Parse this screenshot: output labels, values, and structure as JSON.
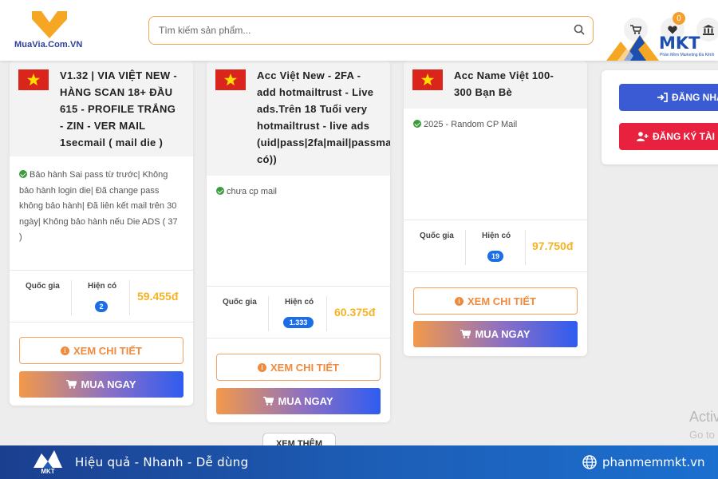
{
  "header": {
    "logo_text": "MuaVia.Com.VN",
    "search_placeholder": "Tìm kiếm sản phẩm...",
    "wishlist_count": "0"
  },
  "overlay_brand": {
    "name": "MKT",
    "tagline": "Phần Mềm Marketing Đa Kênh"
  },
  "products": [
    {
      "title_lines": [
        "V1.32 | VIA VIỆT NEW -",
        "HÀNG SCAN 18+ ĐẦU",
        "615 - PROFILE TRẮNG",
        "- ZIN - VER MAIL",
        "1secmail ( mail die )"
      ],
      "desc_lines": [
        "Bảo hành Sai pass từ trước| Không",
        "bảo hành login die| Đã change pass",
        "không bảo hành| Đã liên kết mail trên 30",
        "ngày| Không bảo hành nếu Die ADS ( 37",
        ")"
      ],
      "country_label": "Quốc gia",
      "stock_label": "Hiện có",
      "stock": "2",
      "price": "59.455đ",
      "detail_label": "XEM CHI TIẾT",
      "buy_label": "MUA NGAY"
    },
    {
      "title_lines": [
        "Acc Việt New - 2FA -",
        "add hotmailtrust - Live",
        "ads.Trên 18 Tuổi very",
        "hotmailtrust - live ads",
        "(uid|pass|2fa|mail|passma",
        "có))"
      ],
      "desc_lines": [
        "chưa cp mail"
      ],
      "country_label": "Quốc gia",
      "stock_label": "Hiện có",
      "stock": "1.333",
      "price": "60.375đ",
      "detail_label": "XEM CHI TIẾT",
      "buy_label": "MUA NGAY"
    },
    {
      "title_lines": [
        "Acc Name Việt 100-",
        "300 Bạn Bè"
      ],
      "desc_lines": [
        "2025 - Random CP Mail"
      ],
      "country_label": "Quốc gia",
      "stock_label": "Hiện có",
      "stock": "19",
      "price": "97.750đ",
      "detail_label": "XEM CHI TIẾT",
      "buy_label": "MUA NGAY"
    }
  ],
  "auth": {
    "login_label": "ĐĂNG NHẬP",
    "register_label": "ĐĂNG KÝ TÀI K"
  },
  "more_label": "XEM THÊM",
  "watermark": {
    "title": "Activ",
    "subtitle": "Go to"
  },
  "footer": {
    "logo_text": "MKT",
    "slogan": "Hiệu quả - Nhanh - Dễ dùng",
    "site": "phanmemmkt.vn"
  },
  "colors": {
    "accent_orange": "#f08a3c",
    "price_yellow": "#f5b323",
    "stock_blue": "#1c6ee8",
    "login_blue": "#3b5bd4",
    "register_red": "#e8213e",
    "footer_blue": "#1d5fb8"
  }
}
